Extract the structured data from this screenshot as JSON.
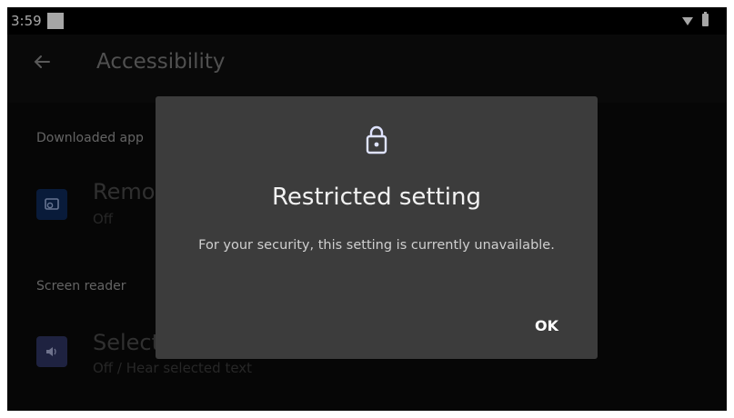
{
  "status_bar": {
    "time": "3:59",
    "icons": [
      "notification-square-icon",
      "wifi-icon",
      "battery-icon"
    ]
  },
  "app_bar": {
    "back_icon": "arrow-left-icon",
    "title": "Accessibility"
  },
  "sections": [
    {
      "header": "Downloaded app",
      "items": [
        {
          "title": "Remot",
          "summary": "Off",
          "icon": "remote-screen-icon",
          "icon_color": "#0e2a5a"
        }
      ]
    },
    {
      "header": "Screen reader",
      "items": [
        {
          "title": "Select",
          "summary": "Off / Hear selected text",
          "icon": "speaker-icon",
          "icon_color": "#2e3563"
        }
      ]
    }
  ],
  "dialog": {
    "icon": "lock-icon",
    "title": "Restricted setting",
    "message": "For your security, this setting is currently unavailable.",
    "ok_label": "OK"
  }
}
